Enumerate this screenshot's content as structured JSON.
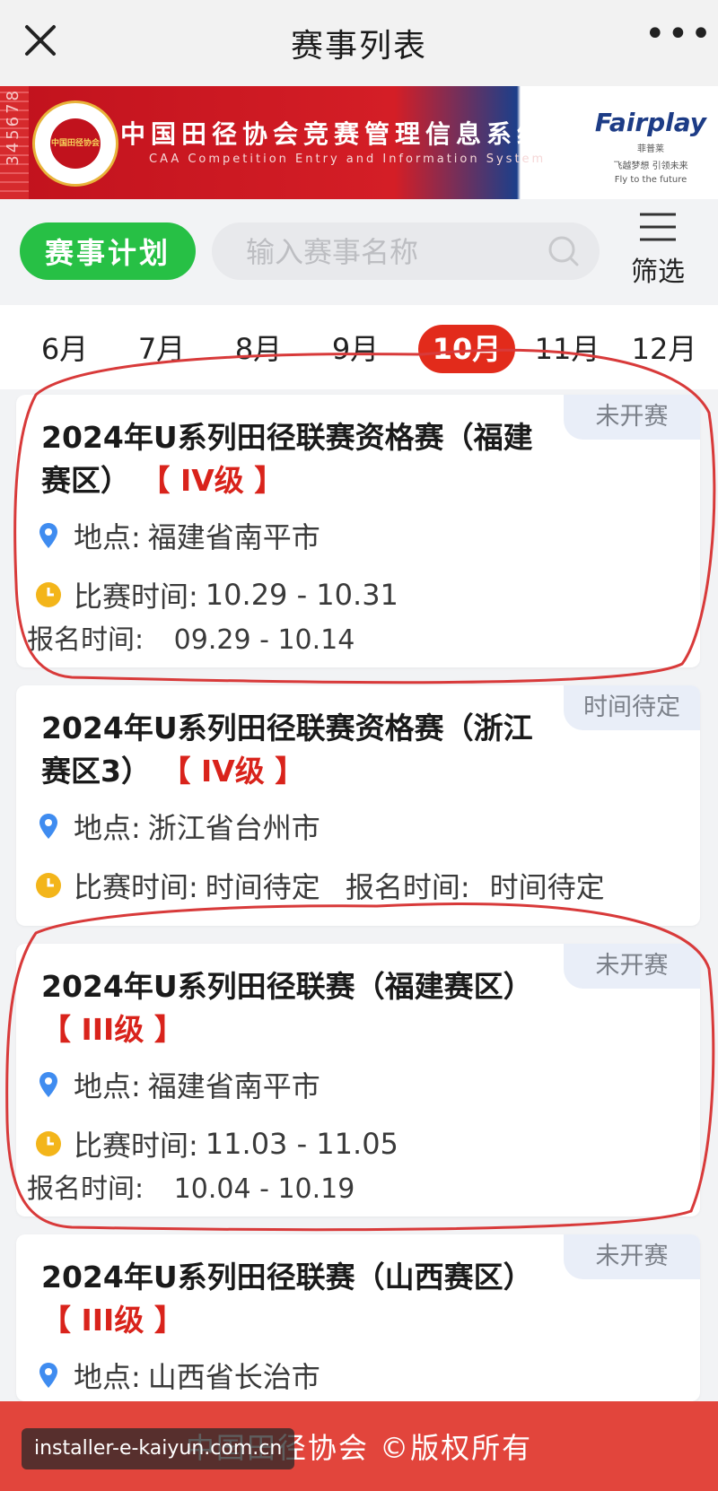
{
  "topbar": {
    "title": "赛事列表",
    "close_icon": "close-icon",
    "more_icon": "more-icon",
    "more": "•••"
  },
  "banner": {
    "lane_numbers": "345678",
    "logo_text": "中国田径协会",
    "title_cn": "中国田径协会竞赛管理信息系统",
    "title_en": "CAA Competition Entry and Information System",
    "partner_brand": "Fairplay",
    "partner_cn": "菲普莱",
    "partner_tag": "飞越梦想 引领未来",
    "partner_tag_en": "Fly to the future"
  },
  "search": {
    "plan_button": "赛事计划",
    "placeholder": "输入赛事名称",
    "value": "",
    "filter_label": "筛选"
  },
  "months": {
    "items": [
      "6月",
      "7月",
      "8月",
      "9月",
      "10月",
      "11月",
      "12月"
    ],
    "active": "10月"
  },
  "cards": [
    {
      "status": "未开赛",
      "title": "2024年U系列田径联赛资格赛（福建赛区）",
      "level": "【 IV级 】",
      "location_key": "地点:",
      "location": "福建省南平市",
      "match_key": "比赛时间:",
      "match": "10.29 - 10.31",
      "reg_key": "报名时间:",
      "reg": "09.29 - 10.14"
    },
    {
      "status": "时间待定",
      "title": "2024年U系列田径联赛资格赛（浙江赛区3）",
      "level": "【 IV级 】",
      "location_key": "地点:",
      "location": "浙江省台州市",
      "match_key": "比赛时间:",
      "match": "时间待定",
      "reg_key": "报名时间:",
      "reg": "时间待定"
    },
    {
      "status": "未开赛",
      "title": "2024年U系列田径联赛（福建赛区）",
      "level": "【 III级 】",
      "location_key": "地点:",
      "location": "福建省南平市",
      "match_key": "比赛时间:",
      "match": "11.03 - 11.05",
      "reg_key": "报名时间:",
      "reg": "10.04 - 10.19"
    },
    {
      "status": "未开赛",
      "title": "2024年U系列田径联赛（山西赛区）",
      "level": "【 III级 】",
      "location_key": "地点:",
      "location": "山西省长治市"
    }
  ],
  "footer": {
    "text": "中国田径协会 ©版权所有"
  },
  "watermark": {
    "text": "installer-e-kaiyun.com.cn"
  },
  "colors": {
    "accent_red": "#e22b1b",
    "green": "#27c045",
    "level_red": "#d9231b",
    "footer_red": "#e2453c"
  }
}
